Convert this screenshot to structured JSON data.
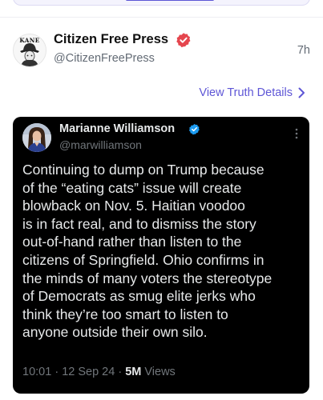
{
  "post": {
    "display_name": "Citizen Free Press",
    "handle": "@CitizenFreePress",
    "time": "7h",
    "avatar_text": "KANE",
    "view_link": "View Truth Details",
    "verified_color": "#e5464e"
  },
  "embedded_tweet": {
    "name": "Marianne Williamson",
    "handle": "@marwilliamson",
    "verified_color": "#1d9bf0",
    "lines": [
      "Continuing to dump on Trump because",
      "of the “eating cats” issue will create",
      "blowback on Nov. 5. Haitian voodoo",
      "is in fact real, and to dismiss the story",
      "out-of-hand rather than listen to the",
      "citizens of Springfield. Ohio confirms in",
      "the minds of many voters the stereotype",
      "of Democrats as smug elite jerks who",
      "think they’re too smart to listen to",
      "anyone outside their own silo."
    ],
    "meta": {
      "time": "10:01",
      "sep1": " · ",
      "date": "12 Sep 24",
      "sep2": " · ",
      "views_count": "5M",
      "views_label": " Views"
    }
  },
  "colors": {
    "link": "#5e56d6",
    "tweet_bg": "#000000",
    "tweet_text": "#e7e9ea",
    "tweet_muted": "#71767b"
  },
  "icons": [
    "verified-badge-icon",
    "chevron-right-icon",
    "more-options-icon"
  ]
}
